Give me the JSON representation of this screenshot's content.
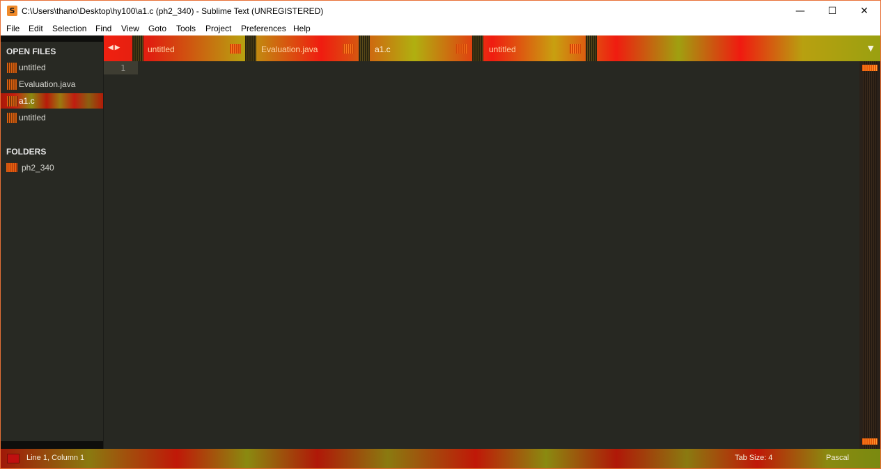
{
  "window": {
    "title": "C:\\Users\\thano\\Desktop\\hy100\\a1.c (ph2_340) - Sublime Text (UNREGISTERED)",
    "app_icon": "S",
    "minimize_glyph": "—",
    "maximize_glyph": "☐",
    "close_glyph": "✕"
  },
  "menu": [
    "File",
    "Edit",
    "Selection",
    "Find",
    "View",
    "Goto",
    "Tools",
    "Project",
    "Preferences",
    "Help"
  ],
  "sidebar": {
    "open_files_title": "OPEN FILES",
    "open_files": [
      {
        "label": "untitled",
        "active": false
      },
      {
        "label": "Evaluation.java",
        "active": false
      },
      {
        "label": "a1.c",
        "active": true
      },
      {
        "label": "untitled",
        "active": false
      }
    ],
    "folders_title": "FOLDERS",
    "folders": [
      {
        "label": "ph2_340"
      }
    ]
  },
  "tabs": {
    "arrows": "◀▶",
    "dropdown": "▼",
    "items": [
      {
        "label": "untitled",
        "active": false
      },
      {
        "label": "Evaluation.java",
        "active": false
      },
      {
        "label": "a1.c",
        "active": true
      },
      {
        "label": "untitled",
        "active": false
      }
    ]
  },
  "editor": {
    "line_numbers": [
      "1"
    ]
  },
  "status": {
    "position": "Line 1, Column 1",
    "tab_size": "Tab Size: 4",
    "syntax": "Pascal"
  }
}
